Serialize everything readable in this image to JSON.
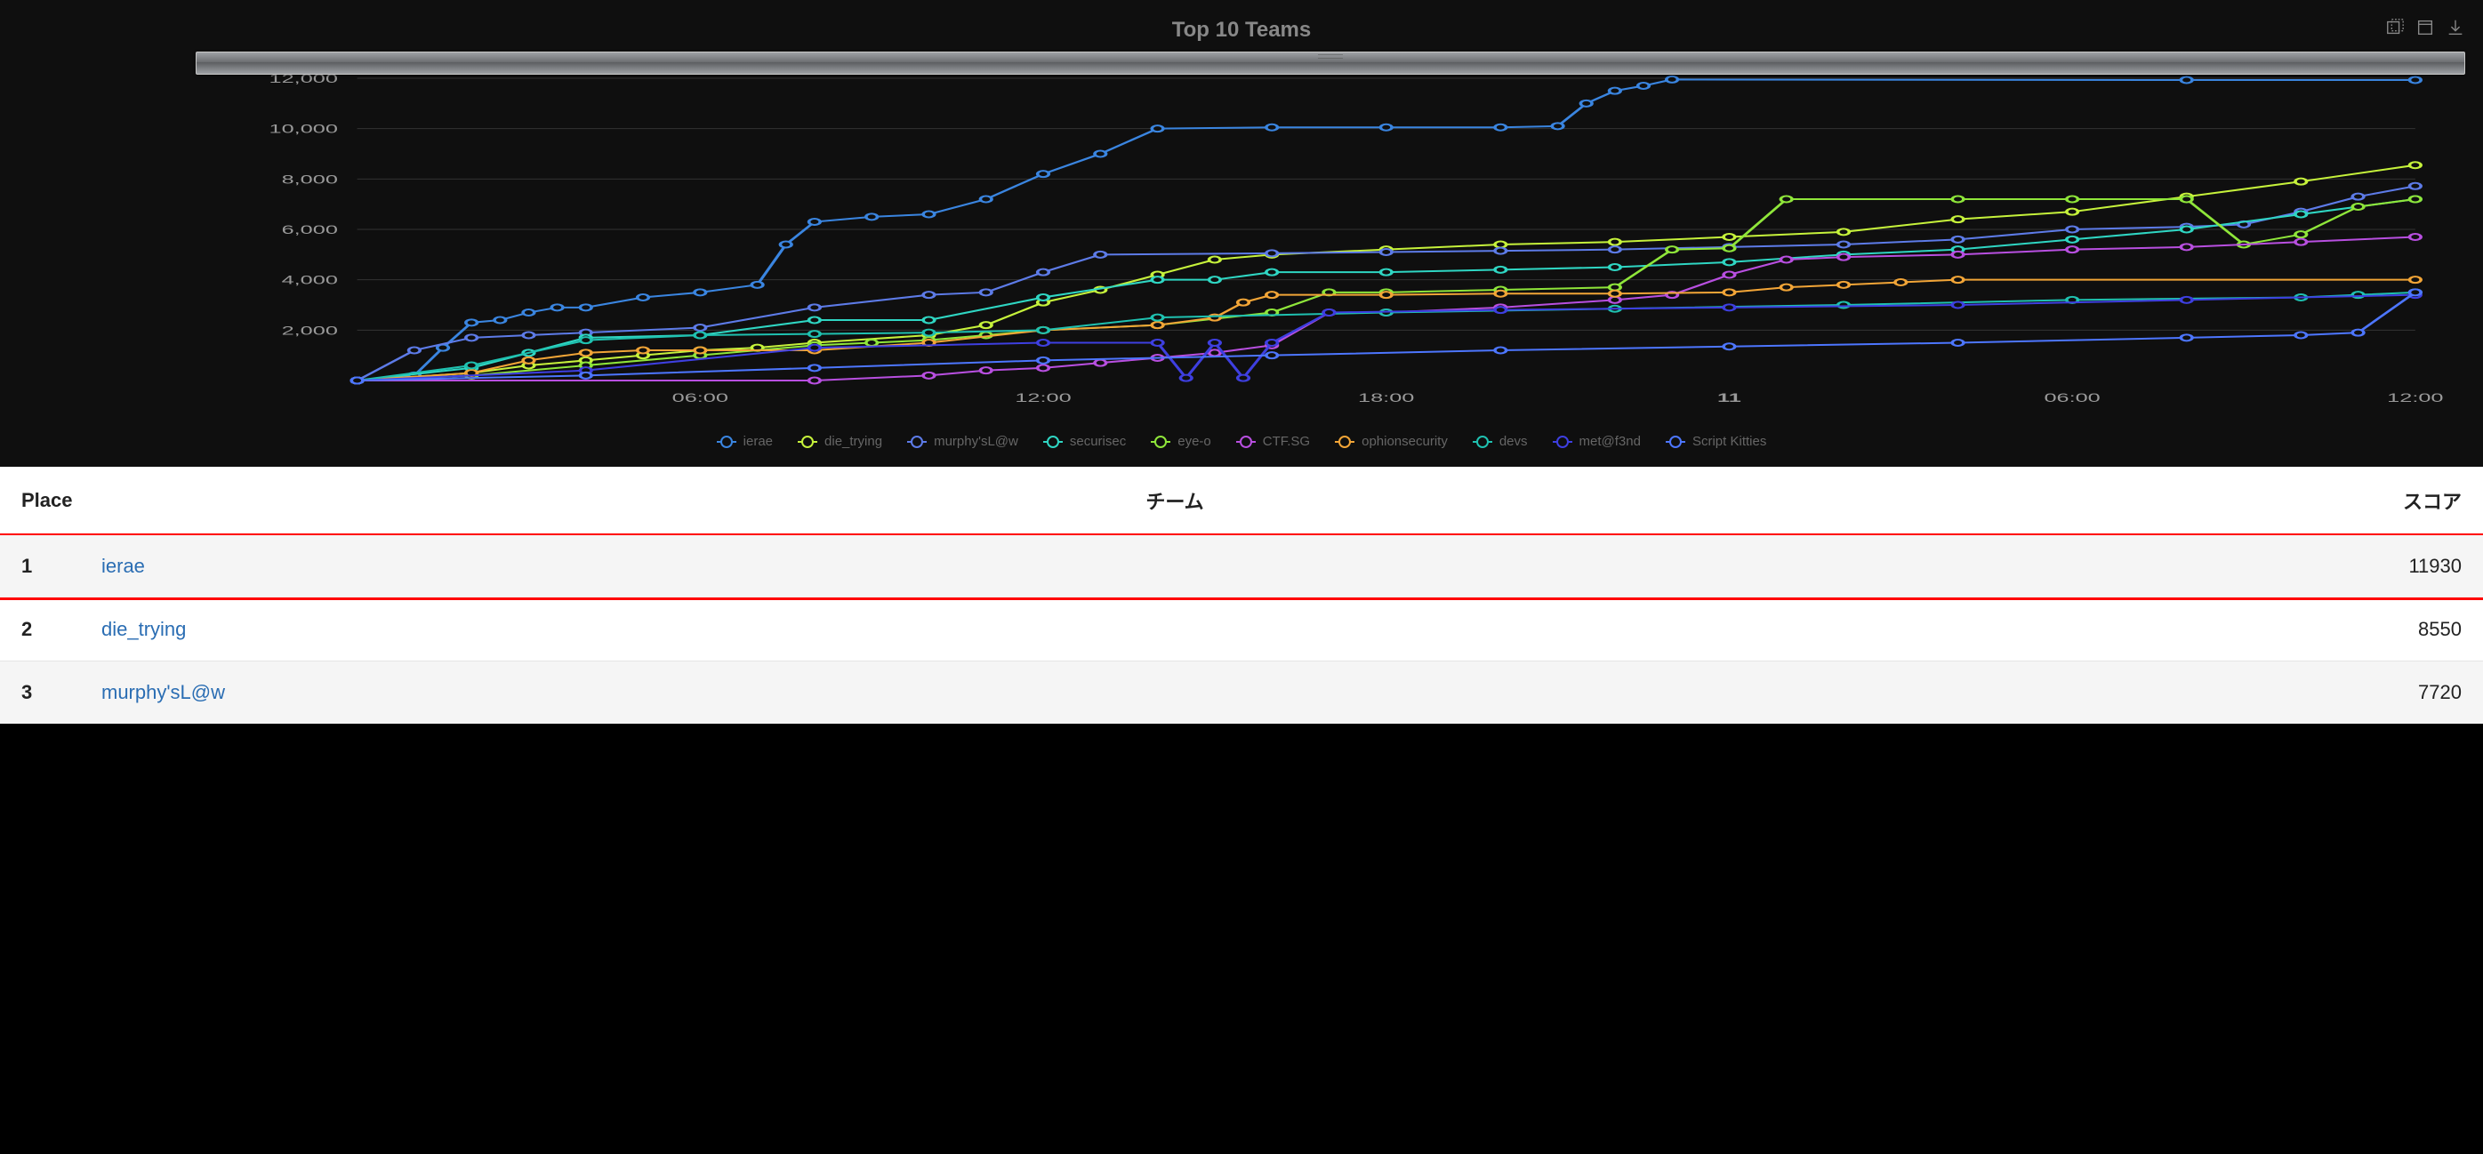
{
  "chart": {
    "title": "Top 10 Teams",
    "toolbar": {
      "zoom": "zoom",
      "restore": "restore",
      "download": "download"
    }
  },
  "chart_data": {
    "type": "line",
    "title": "Top 10 Teams",
    "xlabel": "",
    "ylabel": "",
    "ylim": [
      0,
      12000
    ],
    "y_ticks": [
      2000,
      4000,
      6000,
      8000,
      10000,
      12000
    ],
    "y_tick_labels": [
      "2,000",
      "4,000",
      "6,000",
      "8,000",
      "10,000",
      "12,000"
    ],
    "x_tick_labels": [
      "06:00",
      "12:00",
      "18:00",
      "11",
      "06:00",
      "12:00"
    ],
    "x_range_hours": 36,
    "legend_position": "bottom",
    "series": [
      {
        "name": "ierae",
        "color": "#3a85e0",
        "x": [
          0,
          1,
          1.5,
          2,
          2.5,
          3,
          3.5,
          4,
          5,
          6,
          7,
          7.5,
          8,
          9,
          10,
          11,
          12,
          13,
          14,
          16,
          18,
          20,
          21,
          21.5,
          22,
          22.5,
          23,
          32,
          36
        ],
        "values": [
          0,
          200,
          1300,
          2300,
          2400,
          2700,
          2900,
          2900,
          3300,
          3500,
          3800,
          5400,
          6300,
          6500,
          6600,
          7200,
          8200,
          9000,
          10000,
          10050,
          10050,
          10050,
          10100,
          11000,
          11500,
          11700,
          11950,
          11930,
          11930
        ]
      },
      {
        "name": "die_trying",
        "color": "#c6f23b",
        "x": [
          0,
          2,
          3,
          4,
          5,
          6,
          7,
          8,
          10,
          11,
          12,
          13,
          14,
          15,
          16,
          18,
          20,
          22,
          24,
          26,
          28,
          30,
          32,
          34,
          36
        ],
        "values": [
          0,
          300,
          600,
          800,
          1000,
          1200,
          1300,
          1500,
          1800,
          2200,
          3100,
          3600,
          4200,
          4800,
          5000,
          5200,
          5400,
          5500,
          5700,
          5900,
          6400,
          6700,
          7300,
          7900,
          8550
        ]
      },
      {
        "name": "murphy'sL@w",
        "color": "#5d7be8",
        "x": [
          0,
          1,
          2,
          3,
          4,
          6,
          8,
          10,
          11,
          12,
          13,
          16,
          18,
          20,
          22,
          24,
          26,
          28,
          30,
          32,
          33,
          34,
          35,
          36
        ],
        "values": [
          0,
          1200,
          1700,
          1800,
          1900,
          2100,
          2900,
          3400,
          3500,
          4300,
          5000,
          5050,
          5100,
          5150,
          5200,
          5300,
          5400,
          5600,
          6000,
          6100,
          6200,
          6700,
          7300,
          7720
        ]
      },
      {
        "name": "securisec",
        "color": "#2fd6c3",
        "x": [
          0,
          2,
          3,
          4,
          6,
          8,
          10,
          12,
          14,
          15,
          16,
          18,
          20,
          22,
          24,
          26,
          28,
          30,
          32,
          34,
          36
        ],
        "values": [
          0,
          500,
          1100,
          1700,
          1800,
          2400,
          2400,
          3300,
          4000,
          4000,
          4300,
          4300,
          4400,
          4500,
          4700,
          5000,
          5200,
          5600,
          6000,
          6600,
          7200
        ]
      },
      {
        "name": "eye-o",
        "color": "#8fe63a",
        "x": [
          0,
          2,
          4,
          6,
          8,
          9,
          10,
          11,
          12,
          14,
          16,
          17,
          18,
          20,
          22,
          23,
          24,
          25,
          28,
          30,
          32,
          33,
          34,
          35,
          36
        ],
        "values": [
          0,
          200,
          600,
          1000,
          1400,
          1500,
          1600,
          1800,
          2000,
          2200,
          2700,
          3500,
          3500,
          3600,
          3700,
          5200,
          5250,
          7200,
          7200,
          7200,
          7200,
          5400,
          5800,
          6900,
          7200
        ]
      },
      {
        "name": "CTF.SG",
        "color": "#b84fe0",
        "x": [
          0,
          8,
          10,
          11,
          12,
          13,
          14,
          15,
          16,
          17,
          18,
          20,
          22,
          23,
          24,
          25,
          26,
          28,
          30,
          32,
          34,
          36
        ],
        "values": [
          0,
          0,
          200,
          400,
          500,
          700,
          900,
          1100,
          1400,
          2700,
          2700,
          2900,
          3200,
          3400,
          4200,
          4800,
          4900,
          5000,
          5200,
          5300,
          5500,
          5700
        ]
      },
      {
        "name": "ophionsecurity",
        "color": "#f2a537",
        "x": [
          0,
          2,
          3,
          4,
          5,
          6,
          8,
          10,
          12,
          14,
          15,
          15.5,
          16,
          18,
          20,
          22,
          24,
          25,
          26,
          27,
          28,
          36
        ],
        "values": [
          0,
          300,
          800,
          1100,
          1200,
          1200,
          1200,
          1500,
          2000,
          2200,
          2500,
          3100,
          3400,
          3400,
          3450,
          3450,
          3500,
          3700,
          3800,
          3900,
          4000,
          4000
        ]
      },
      {
        "name": "devs",
        "color": "#1fc1b0",
        "x": [
          0,
          2,
          4,
          6,
          8,
          10,
          12,
          14,
          18,
          22,
          26,
          30,
          34,
          35,
          36
        ],
        "values": [
          0,
          600,
          1600,
          1800,
          1850,
          1900,
          2000,
          2500,
          2700,
          2850,
          3000,
          3200,
          3300,
          3400,
          3500
        ]
      },
      {
        "name": "met@f3nd",
        "color": "#3e3fe0",
        "x": [
          0,
          4,
          8,
          12,
          14,
          14.5,
          15,
          15.5,
          16,
          17,
          20,
          24,
          28,
          32,
          36
        ],
        "values": [
          0,
          400,
          1300,
          1500,
          1500,
          100,
          1500,
          100,
          1500,
          2700,
          2800,
          2900,
          3000,
          3200,
          3400
        ]
      },
      {
        "name": "Script Kitties",
        "color": "#4d76ff",
        "x": [
          0,
          4,
          8,
          12,
          16,
          20,
          24,
          28,
          32,
          34,
          35,
          36
        ],
        "values": [
          0,
          200,
          500,
          800,
          1000,
          1200,
          1350,
          1500,
          1700,
          1800,
          1900,
          3500
        ]
      }
    ]
  },
  "table": {
    "headers": {
      "place": "Place",
      "team": "チーム",
      "score": "スコア"
    },
    "rows": [
      {
        "place": "1",
        "team": "ierae",
        "score": "11930",
        "highlight": true
      },
      {
        "place": "2",
        "team": "die_trying",
        "score": "8550",
        "highlight": false
      },
      {
        "place": "3",
        "team": "murphy'sL@w",
        "score": "7720",
        "highlight": false
      }
    ]
  }
}
